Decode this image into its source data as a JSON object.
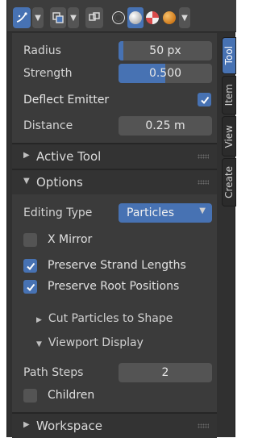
{
  "header": {
    "selection_mode": "particle-select-icon",
    "overlay": "overlay-icon",
    "viewport_gizmo": "gizmo-icon",
    "shading_modes": [
      "wireframe-icon",
      "solid-icon",
      "material-icon",
      "rendered-icon"
    ]
  },
  "tool_settings": {
    "radius": {
      "label": "Radius",
      "value": "50 px",
      "fill": 0.05
    },
    "strength": {
      "label": "Strength",
      "value": "0.500",
      "fill": 0.5
    },
    "deflect_emitter": {
      "label": "Deflect Emitter",
      "checked": true
    },
    "distance": {
      "label": "Distance",
      "value": "0.25 m"
    }
  },
  "sections": {
    "active_tool": "Active Tool",
    "options": "Options",
    "workspace": "Workspace"
  },
  "options": {
    "editing_type_label": "Editing Type",
    "editing_type_value": "Particles",
    "x_mirror": {
      "label": "X Mirror",
      "checked": false
    },
    "preserve_strand_lengths": {
      "label": "Preserve Strand Lengths",
      "checked": true
    },
    "preserve_root_positions": {
      "label": "Preserve Root Positions",
      "checked": true
    },
    "cut_particles_to_shape": "Cut Particles to Shape",
    "viewport_display": "Viewport Display",
    "path_steps": {
      "label": "Path Steps",
      "value": "2"
    },
    "children": {
      "label": "Children",
      "checked": false
    }
  },
  "sidebar_tabs": [
    "Tool",
    "Item",
    "View",
    "Create"
  ],
  "active_tab": "Tool",
  "colors": {
    "accent": "#4772b3",
    "panel": "#3b3b3b",
    "field": "#545454"
  }
}
